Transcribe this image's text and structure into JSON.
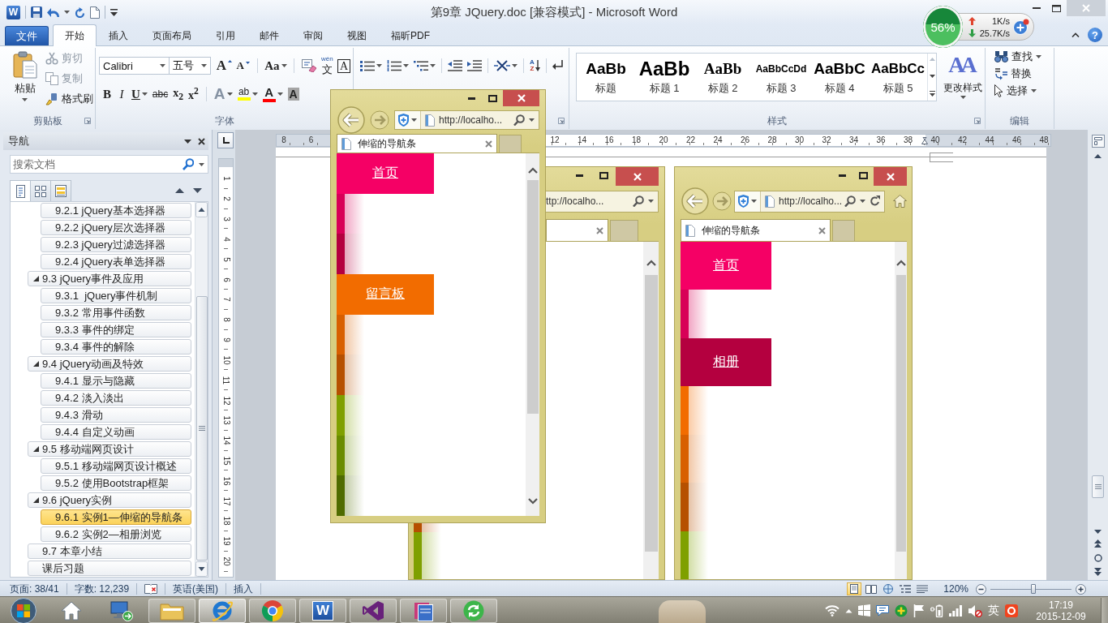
{
  "window": {
    "app_icon": "W",
    "title": "第9章 JQuery.doc [兼容模式] - Microsoft Word"
  },
  "ribbon_tabs": [
    {
      "kind": "backstage",
      "label": "文件",
      "selected": false
    },
    {
      "kind": "tab",
      "label": "开始",
      "selected": true
    },
    {
      "kind": "tab",
      "label": "插入",
      "selected": false
    },
    {
      "kind": "tab",
      "label": "页面布局",
      "selected": false
    },
    {
      "kind": "tab",
      "label": "引用",
      "selected": false
    },
    {
      "kind": "tab",
      "label": "邮件",
      "selected": false
    },
    {
      "kind": "tab",
      "label": "审阅",
      "selected": false
    },
    {
      "kind": "tab",
      "label": "视图",
      "selected": false
    },
    {
      "kind": "tab",
      "label": "福昕PDF",
      "selected": false
    }
  ],
  "help_button": "?",
  "net_monitor": {
    "percent": "56%",
    "level": 0.56,
    "upload": "1K/s",
    "download": "25.7K/s"
  },
  "clipboard": {
    "label": "剪贴板",
    "paste": "粘贴",
    "commands": [
      {
        "kind": "cut",
        "label": "剪切",
        "disabled": true
      },
      {
        "kind": "copy",
        "label": "复制",
        "disabled": true
      },
      {
        "kind": "format_painter",
        "label": "格式刷",
        "disabled": false
      }
    ]
  },
  "font": {
    "label": "字体",
    "font_name": "Calibri",
    "font_size": "五号",
    "row1": [
      {
        "kind": "grow",
        "glyph": "A",
        "disabled": false
      },
      {
        "kind": "shrink",
        "glyph": "A",
        "disabled": false
      },
      {
        "kind": "case",
        "glyph": "Aa",
        "dropdown": true,
        "disabled": false
      },
      {
        "kind": "clear",
        "disabled": false
      },
      {
        "kind": "phonetic",
        "ruby": "wén",
        "glyph": "文",
        "disabled": false
      },
      {
        "kind": "border",
        "glyph": "A",
        "disabled": false
      }
    ],
    "row2": [
      {
        "kind": "bold",
        "glyph": "B",
        "disabled": false
      },
      {
        "kind": "italic",
        "glyph": "I",
        "disabled": false
      },
      {
        "kind": "underline",
        "glyph": "U",
        "dropdown": true,
        "disabled": false
      },
      {
        "kind": "strike",
        "glyph": "abc",
        "disabled": false
      },
      {
        "kind": "sub",
        "glyph": "x$_{2}$",
        "disabled": false
      },
      {
        "kind": "sup",
        "glyph": "x$^{2}$",
        "disabled": false
      },
      {
        "kind": "effects",
        "glyph": "A",
        "dropdown": true,
        "disabled": true
      },
      {
        "kind": "highlight",
        "glyph": "ab",
        "color": "#ffff00",
        "dropdown": true,
        "disabled": false
      },
      {
        "kind": "font_color",
        "glyph": "A",
        "color": "#ff0000",
        "dropdown": true,
        "disabled": false
      },
      {
        "kind": "shading",
        "glyph": "A",
        "disabled": false
      }
    ]
  },
  "paragraph": {
    "tools": [
      {
        "kind": "bullets",
        "dropdown": true
      },
      {
        "kind": "numbering",
        "dropdown": true
      },
      {
        "kind": "multilevel",
        "dropdown": true
      },
      {
        "kind": "outdent"
      },
      {
        "kind": "indent"
      },
      {
        "kind": "asian_layout",
        "dropdown": true
      },
      {
        "kind": "sort",
        "glyph": "A",
        "glyph2": "Z"
      },
      {
        "kind": "marks"
      }
    ]
  },
  "styles": {
    "label": "样式",
    "gallery": [
      {
        "sample": "AaBb",
        "name": "标题",
        "selected": false
      },
      {
        "sample": "AaBb",
        "name": "标题 1",
        "selected": false
      },
      {
        "sample": "AaBb",
        "name": "标题 2",
        "selected": false
      },
      {
        "sample": "AaBbCcDd",
        "name": "标题 3",
        "selected": false
      },
      {
        "sample": "AaBbC",
        "name": "标题 4",
        "selected": false
      },
      {
        "sample": "AaBbCc",
        "name": "标题 5",
        "selected": false
      }
    ],
    "change_styles": {
      "glyph": "AA",
      "label": "更改样式"
    }
  },
  "editing": {
    "label": "编辑",
    "commands": [
      {
        "kind": "find",
        "label": "查找",
        "dropdown": true
      },
      {
        "kind": "replace",
        "label": "替换",
        "dropdown": false
      },
      {
        "kind": "select",
        "label": "选择",
        "dropdown": true
      }
    ]
  },
  "navigation": {
    "title": "导航",
    "search": {
      "placeholder": "搜索文档"
    },
    "view_tabs": [
      {
        "kind": "headings",
        "selected": true
      },
      {
        "kind": "pages",
        "selected": false
      },
      {
        "kind": "results",
        "selected": false
      }
    ],
    "headings": [
      {
        "children": [
          {
            "label": "9.2.1 jQuery基本选择器",
            "selected": false
          },
          {
            "label": "9.2.2 jQuery层次选择器",
            "selected": false
          },
          {
            "label": "9.2.3 jQuery过滤选择器",
            "selected": false
          },
          {
            "label": "9.2.4 jQuery表单选择器",
            "selected": false
          }
        ]
      },
      {
        "label": "9.3 jQuery事件及应用",
        "selected": false,
        "expanded": true,
        "children": [
          {
            "label": "9.3.1  jQuery事件机制",
            "selected": false
          },
          {
            "label": "9.3.2 常用事件函数",
            "selected": false
          },
          {
            "label": "9.3.3 事件的绑定",
            "selected": false
          },
          {
            "label": "9.3.4 事件的解除",
            "selected": false
          }
        ]
      },
      {
        "label": "9.4 jQuery动画及特效",
        "selected": false,
        "expanded": true,
        "children": [
          {
            "label": "9.4.1 显示与隐藏",
            "selected": false
          },
          {
            "label": "9.4.2 淡入淡出",
            "selected": false
          },
          {
            "label": "9.4.3 滑动",
            "selected": false
          },
          {
            "label": "9.4.4 自定义动画",
            "selected": false
          }
        ]
      },
      {
        "label": "9.5 移动端网页设计",
        "selected": false,
        "expanded": true,
        "children": [
          {
            "label": "9.5.1 移动端网页设计概述",
            "selected": false
          },
          {
            "label": "9.5.2 使用Bootstrap框架",
            "selected": false
          }
        ]
      },
      {
        "label": "9.6 jQuery实例",
        "selected": false,
        "expanded": true,
        "children": [
          {
            "label": "9.6.1 实例1—伸缩的导航条",
            "selected": true
          },
          {
            "label": "9.6.2 实例2—相册浏览",
            "selected": false
          }
        ]
      },
      {
        "label": "9.7 本章小结",
        "selected": false
      },
      {
        "label": "课后习题",
        "selected": false
      }
    ]
  },
  "horizontal_ruler": {
    "left_labels": [
      "8",
      "6"
    ],
    "right_labels": [
      "12",
      "14",
      "16",
      "18",
      "20",
      "22",
      "24",
      "26",
      "28",
      "30",
      "32",
      "34",
      "36",
      "38",
      "40",
      "42",
      "44",
      "46",
      "48"
    ]
  },
  "vertical_ruler": {
    "labels": [
      "1",
      "2",
      "3",
      "4",
      "5",
      "6",
      "7",
      "8",
      "9",
      "10",
      "11",
      "12",
      "13",
      "14",
      "15",
      "16",
      "17",
      "18",
      "19",
      "20"
    ]
  },
  "browser_windows": [
    {
      "url": "http://localho...",
      "tab_title": "伸缩的导航条",
      "nav_items": [
        {
          "label": "首页",
          "expanded": true,
          "color": "#f50065"
        },
        {
          "expanded": false,
          "color": "#d80057"
        },
        {
          "expanded": false,
          "color": "#b4003f"
        },
        {
          "label": "留言板",
          "expanded": true,
          "color": "#f26c00"
        },
        {
          "expanded": false,
          "color": "#d85f00"
        },
        {
          "expanded": false,
          "color": "#b65000"
        },
        {
          "expanded": false,
          "color": "#7fa000"
        },
        {
          "expanded": false,
          "color": "#6a8c00"
        },
        {
          "expanded": false,
          "color": "#4f6b00"
        }
      ]
    },
    {
      "url": "ttp://localho...",
      "nav_items": [
        {
          "expanded": false,
          "color": "#b65000"
        },
        {
          "expanded": false,
          "color": "#7fa000"
        }
      ]
    },
    {
      "url": "http://localho...",
      "tab_title": "伸缩的导航条",
      "nav_items": [
        {
          "label": "首页",
          "expanded": true,
          "color": "#f50065"
        },
        {
          "expanded": false,
          "color": "#d80057"
        },
        {
          "label": "相册",
          "expanded": true,
          "color": "#b4003f"
        },
        {
          "expanded": false,
          "color": "#f26c00"
        },
        {
          "expanded": false,
          "color": "#d85f00"
        },
        {
          "expanded": false,
          "color": "#b65000"
        },
        {
          "expanded": false,
          "color": "#7fa000"
        }
      ]
    }
  ],
  "status_bar": {
    "page": "页面: 38/41",
    "words": "字数: 12,239",
    "language": "英语(美国)",
    "mode": "插入",
    "view_buttons": [
      {
        "kind": "print_layout",
        "selected": true
      },
      {
        "kind": "full_screen",
        "selected": false
      },
      {
        "kind": "web_layout",
        "selected": false
      },
      {
        "kind": "outline",
        "selected": false
      },
      {
        "kind": "draft",
        "selected": false
      }
    ],
    "zoom": "120%",
    "zoom_slider": {
      "level": 0.53
    }
  },
  "taskbar": {
    "apps": [
      {
        "kind": "home",
        "running": false,
        "active": false
      },
      {
        "kind": "remote",
        "running": false,
        "active": false
      },
      {
        "kind": "folder",
        "running": true,
        "active": false
      },
      {
        "kind": "ie",
        "running": true,
        "active": true
      },
      {
        "kind": "chrome",
        "running": true,
        "active": false
      },
      {
        "kind": "word",
        "label": "W",
        "running": true,
        "active": false
      },
      {
        "kind": "vs",
        "running": true,
        "active": false
      },
      {
        "kind": "book",
        "running": true,
        "active": false
      },
      {
        "kind": "green_arrows",
        "running": true,
        "active": false
      }
    ],
    "tray": {
      "ime": "英",
      "time": "17:19",
      "date": "2015-12-09"
    }
  }
}
